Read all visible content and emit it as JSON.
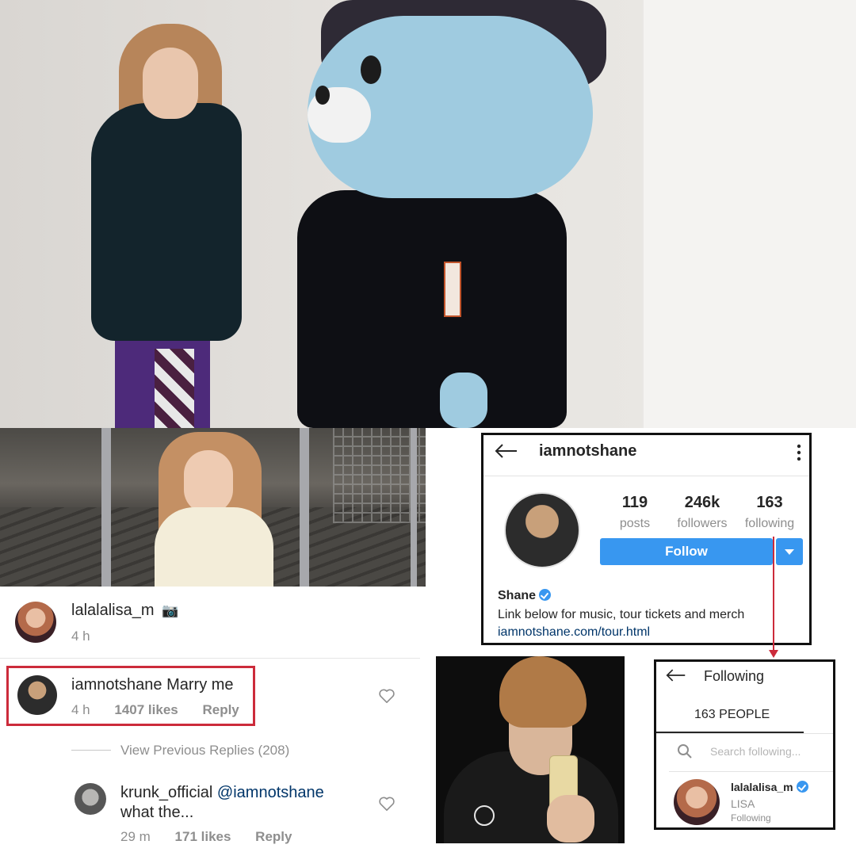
{
  "post": {
    "author": "lalalalisa_m",
    "author_emoji": "📷",
    "time": "4 h"
  },
  "comments": [
    {
      "username": "iamnotshane",
      "text": "Marry me",
      "time": "4 h",
      "likes": "1407 likes",
      "reply_label": "Reply",
      "highlighted": true
    },
    {
      "username": "krunk_official",
      "text": "@iamnotshane",
      "text_line2": "what the...",
      "time": "29 m",
      "likes": "171 likes",
      "reply_label": "Reply"
    }
  ],
  "view_previous_replies": "View Previous Replies (208)",
  "profile": {
    "username": "iamnotshane",
    "stats": [
      {
        "value": "119",
        "label": "posts"
      },
      {
        "value": "246k",
        "label": "followers"
      },
      {
        "value": "163",
        "label": "following"
      }
    ],
    "follow_label": "Follow",
    "name": "Shane",
    "bio": "Link below for music, tour tickets and merch",
    "link": "iamnotshane.com/tour.html"
  },
  "following": {
    "title": "Following",
    "count_label": "163 PEOPLE",
    "search_placeholder": "Search following...",
    "entry": {
      "username": "lalalalisa_m",
      "full_name": "LISA",
      "status": "Following"
    }
  },
  "colors": {
    "accent_blue": "#3897f0",
    "highlight_red": "#cc2b3b",
    "muted_text": "#8e8e8e",
    "link_blue": "#003569"
  },
  "icons": {
    "back": "arrow-left-icon",
    "menu": "more-vertical-icon",
    "heart": "heart-outline-icon",
    "verified": "verified-badge-icon",
    "search": "search-icon",
    "camera": "camera-flash-icon"
  }
}
